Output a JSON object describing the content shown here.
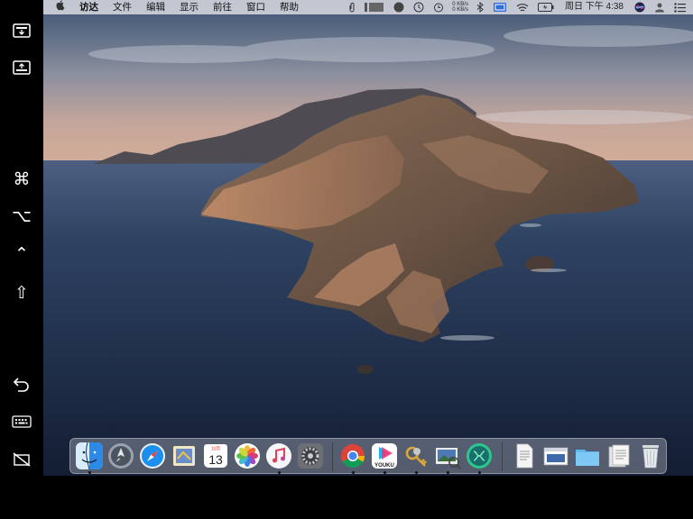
{
  "sidebar": {
    "buttons": [
      {
        "name": "screen-top-icon"
      },
      {
        "name": "screen-bottom-icon"
      },
      {
        "name": "command-key",
        "glyph": "⌘"
      },
      {
        "name": "option-key",
        "glyph": "⌥"
      },
      {
        "name": "control-key",
        "glyph": "⌃"
      },
      {
        "name": "shift-key",
        "glyph": "⇧"
      },
      {
        "name": "undo-icon"
      },
      {
        "name": "keyboard-icon"
      },
      {
        "name": "disconnect-icon"
      }
    ]
  },
  "menubar": {
    "apple": "",
    "items": [
      "访达",
      "文件",
      "编辑",
      "显示",
      "前往",
      "窗口",
      "帮助"
    ],
    "network": {
      "up": "0 KB/s",
      "down": "0 KB/s"
    },
    "clock": "周日 下午 4:38"
  },
  "dock": {
    "apps": [
      "finder",
      "launchpad",
      "safari",
      "mail",
      "calendar",
      "photos",
      "music",
      "system-preferences",
      "chrome",
      "youku",
      "keychain",
      "preview",
      "mindnode",
      "document-1",
      "document-2",
      "folder",
      "document-3",
      "trash"
    ],
    "calendar": {
      "month": "10月",
      "day": "13"
    },
    "youku_label": "YOUKU"
  },
  "colors": {
    "menubar": "#e1e1e6",
    "accent": "#2f6fd6"
  }
}
